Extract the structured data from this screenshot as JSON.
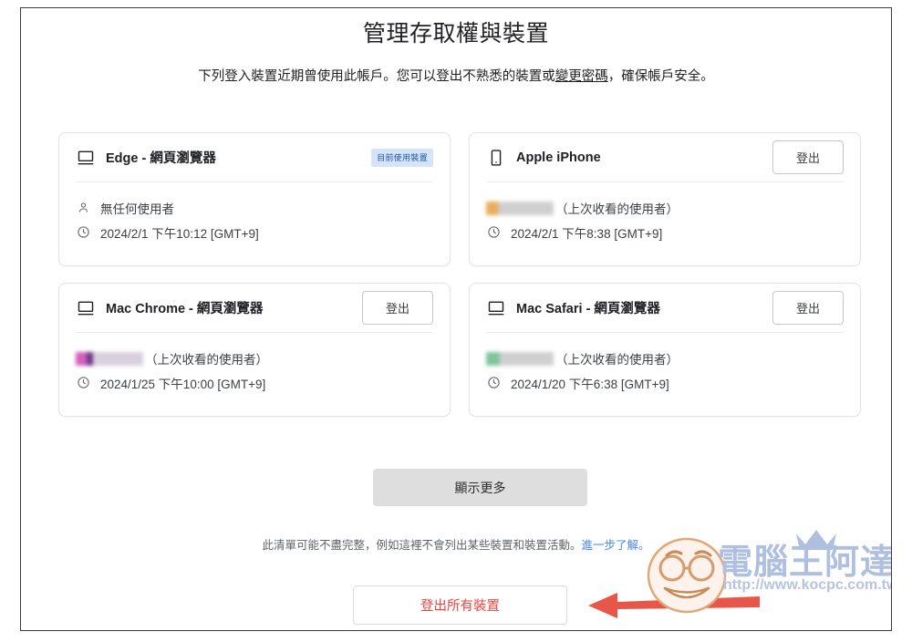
{
  "page": {
    "title": "管理存取權與裝置",
    "description_part1": "下列登入裝置近期曾使用此帳戶。您可以登出不熟悉的裝置或",
    "description_link": "變更密碼",
    "description_part2": "，確保帳戶安全。"
  },
  "devices": [
    {
      "name": "Edge - 網頁瀏覽器",
      "icon": "monitor-icon",
      "badge": "目前使用裝置",
      "action": null,
      "user_icon": "person-icon",
      "user_text": "無任何使用者",
      "user_redacted": false,
      "time_icon": "clock-icon",
      "time": "2024/2/1 下午10:12 [GMT+9]"
    },
    {
      "name": "Apple iPhone",
      "icon": "phone-icon",
      "badge": null,
      "action": "登出",
      "user_icon": null,
      "user_text": "（上次收看的使用者）",
      "user_redacted": true,
      "redaction_color": "tan",
      "time_icon": "clock-icon",
      "time": "2024/2/1 下午8:38 [GMT+9]"
    },
    {
      "name": "Mac Chrome - 網頁瀏覽器",
      "icon": "monitor-icon",
      "badge": null,
      "action": "登出",
      "user_icon": null,
      "user_text": "（上次收看的使用者）",
      "user_redacted": true,
      "redaction_color": "pink",
      "time_icon": "clock-icon",
      "time": "2024/1/25 下午10:00 [GMT+9]"
    },
    {
      "name": "Mac Safari - 網頁瀏覽器",
      "icon": "monitor-icon",
      "badge": null,
      "action": "登出",
      "user_icon": null,
      "user_text": "（上次收看的使用者）",
      "user_redacted": true,
      "redaction_color": "green",
      "time_icon": "clock-icon",
      "time": "2024/1/20 下午6:38 [GMT+9]"
    }
  ],
  "show_more": {
    "label": "顯示更多"
  },
  "footer": {
    "note": "此清單可能不盡完整，例如這裡不會列出某些裝置和裝置活動。",
    "link": "進一步了解。"
  },
  "sign_out_all": {
    "label": "登出所有裝置"
  },
  "watermark": {
    "brand": "電腦王阿達",
    "url": "http://www.kocpc.com.tw"
  },
  "colors": {
    "badge_bg": "#d6e4fb",
    "badge_text": "#1a53b0",
    "danger": "#e8453c",
    "link": "#4285f4",
    "arrow": "#e8564a"
  }
}
